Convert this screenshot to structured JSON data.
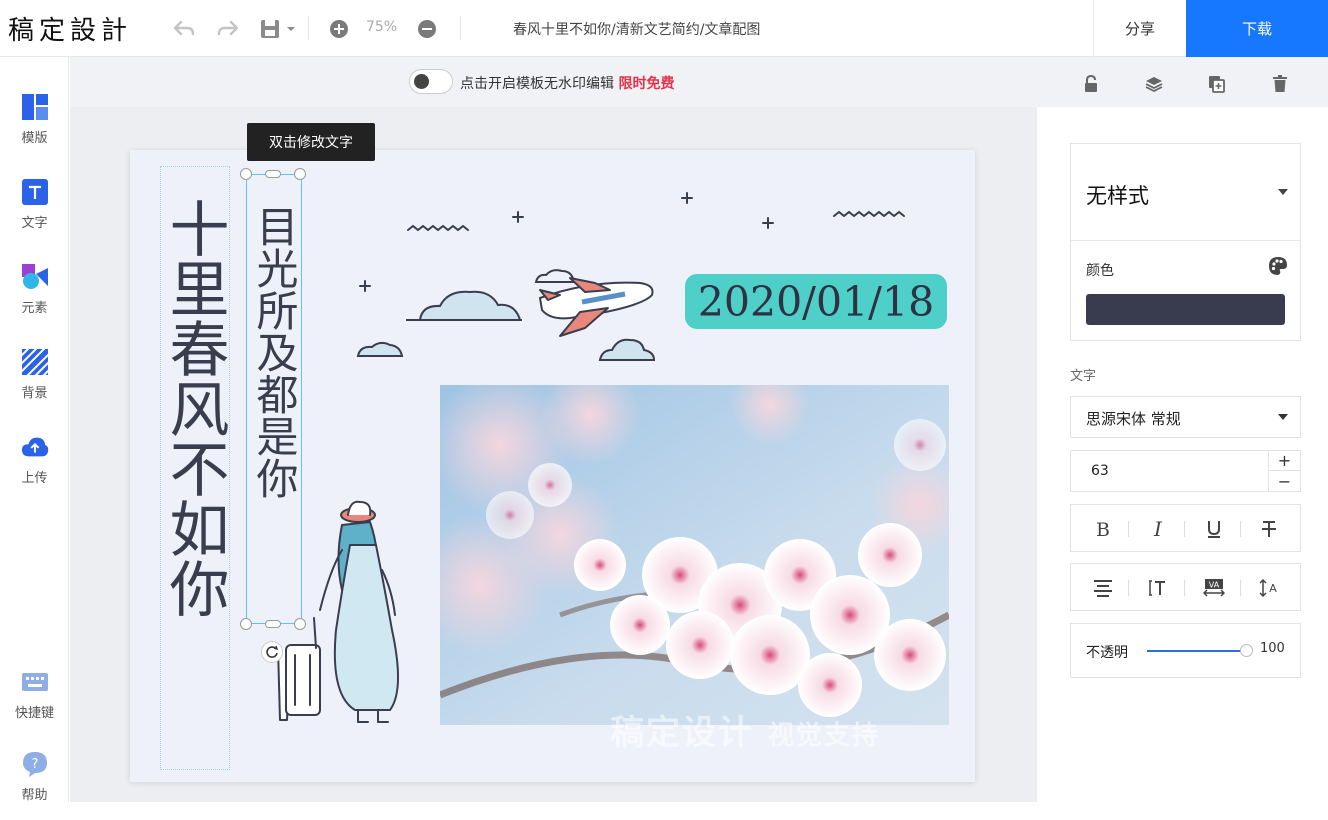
{
  "app": {
    "logo": "稿定設計"
  },
  "toolbar": {
    "zoom": "75%",
    "doc_title": "春风十里不如你/清新文艺简约/文章配图",
    "share_label": "分享",
    "download_label": "下载",
    "icons": [
      "undo-icon",
      "redo-icon",
      "save-icon",
      "zoom-in-icon",
      "zoom-out-icon"
    ]
  },
  "sidebar": {
    "items": [
      {
        "label": "模版",
        "icon": "template-icon"
      },
      {
        "label": "文字",
        "icon": "text-icon"
      },
      {
        "label": "元素",
        "icon": "element-icon"
      },
      {
        "label": "背景",
        "icon": "background-icon"
      },
      {
        "label": "上传",
        "icon": "upload-icon"
      },
      {
        "label": "快捷键",
        "icon": "keyboard-icon"
      },
      {
        "label": "帮助",
        "icon": "help-icon"
      }
    ]
  },
  "canvas_toolbar": {
    "watermark_text": "点击开启模板无水印编辑",
    "free_text": "限时免费",
    "toggle_on": false,
    "icons": [
      "lock-icon",
      "layers-icon",
      "duplicate-icon",
      "delete-icon"
    ]
  },
  "canvas": {
    "tooltip": "双击修改文字",
    "big_title": "十里春风不如你",
    "sub_title": "目光所及都是你",
    "date": "2020/01/18",
    "photo_watermark": "稿定设计",
    "photo_watermark_small": "视觉支持"
  },
  "panel": {
    "style_name": "无样式",
    "color_label": "颜色",
    "color_value": "#393c4f",
    "text_label": "文字",
    "font_name": "思源宋体 常规",
    "font_size": "63",
    "size_plus": "+",
    "size_minus": "−",
    "format_icons": [
      "bold-icon",
      "italic-icon",
      "underline-icon",
      "strikethrough-icon"
    ],
    "align_icons": [
      "align-icon",
      "text-direction-icon",
      "letter-spacing-icon",
      "line-height-icon"
    ],
    "opacity_label": "不透明",
    "opacity_value": "100",
    "opacity_fraction": 1.0
  },
  "colors": {
    "accent": "#1677ff",
    "date_badge": "#4ecfc7",
    "free_red": "#e3334a"
  }
}
